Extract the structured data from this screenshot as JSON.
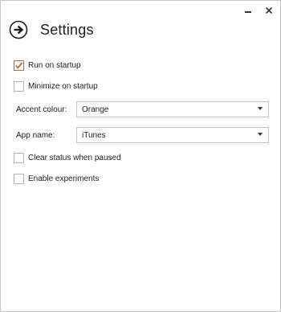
{
  "window": {
    "minimize_icon": "minimize-icon",
    "close_icon": "close-icon"
  },
  "header": {
    "back_icon": "arrow-right-circle-icon",
    "title": "Settings"
  },
  "options": {
    "run_on_startup": {
      "label": "Run on startup",
      "checked": true
    },
    "minimize_on_startup": {
      "label": "Minimize on startup",
      "checked": false
    },
    "clear_status_when_paused": {
      "label": "Clear status when paused",
      "checked": false
    },
    "enable_experiments": {
      "label": "Enable experiments",
      "checked": false
    }
  },
  "accent_colour": {
    "label": "Accent colour:",
    "value": "Orange"
  },
  "app_name": {
    "label": "App name:",
    "value": "iTunes"
  },
  "colors": {
    "checkbox_accent": "#c0672a",
    "text": "#1e1e1e",
    "border": "#c6c6c6"
  }
}
